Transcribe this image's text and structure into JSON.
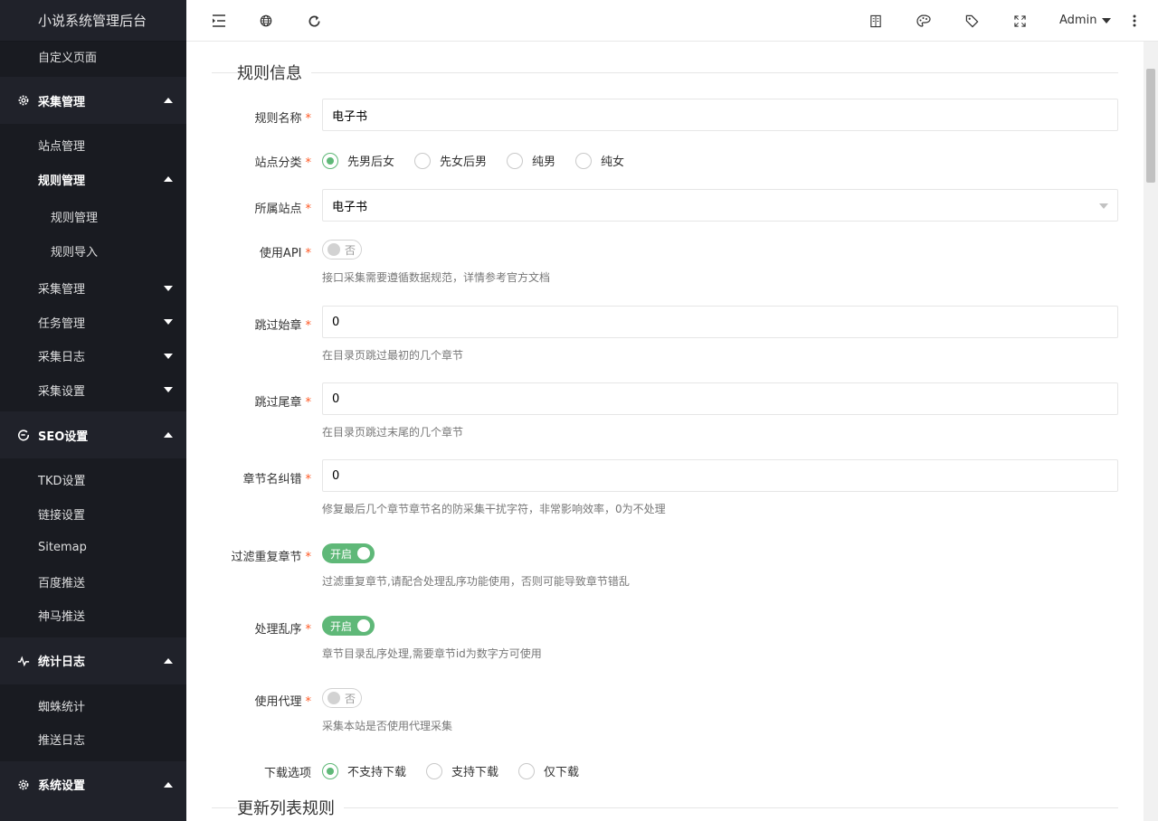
{
  "sidebar": {
    "title": "小说系统管理后台",
    "top_item": "自定义页面",
    "groups": [
      {
        "label": "采集管理",
        "icon": "gear-icon"
      },
      {
        "label": "SEO设置",
        "icon": "refresh-c-icon"
      },
      {
        "label": "统计日志",
        "icon": "pulse-icon"
      },
      {
        "label": "系统设置",
        "icon": "gear-icon"
      }
    ],
    "collect_items": {
      "site": "站点管理",
      "rule": "规则管理",
      "rule_sub": [
        "规则管理",
        "规则导入"
      ],
      "collect": "采集管理",
      "task": "任务管理",
      "log": "采集日志",
      "settings": "采集设置"
    },
    "seo_items": [
      "TKD设置",
      "链接设置",
      "Sitemap",
      "百度推送",
      "神马推送"
    ],
    "stat_items": [
      "蜘蛛统计",
      "推送日志"
    ]
  },
  "topbar": {
    "user": "Admin",
    "icons": [
      "menu-fold-icon",
      "globe-icon",
      "refresh-icon",
      "book-icon",
      "palette-icon",
      "tag-icon",
      "fullscreen-icon",
      "more-vertical-icon"
    ]
  },
  "form": {
    "section_title": "规则信息",
    "next_section_title": "更新列表规则",
    "rule_name": {
      "label": "规则名称",
      "value": "电子书"
    },
    "site_category": {
      "label": "站点分类",
      "options": [
        "先男后女",
        "先女后男",
        "纯男",
        "纯女"
      ],
      "selected": "先男后女"
    },
    "site": {
      "label": "所属站点",
      "value": "电子书"
    },
    "use_api": {
      "label": "使用API",
      "state": "否",
      "help": "接口采集需要遵循数据规范，详情参考官方文档"
    },
    "skip_start": {
      "label": "跳过始章",
      "value": "0",
      "help": "在目录页跳过最初的几个章节"
    },
    "skip_end": {
      "label": "跳过尾章",
      "value": "0",
      "help": "在目录页跳过末尾的几个章节"
    },
    "chapter_fix": {
      "label": "章节名纠错",
      "value": "0",
      "help": "修复最后几个章节章节名的防采集干扰字符，非常影响效率，0为不处理"
    },
    "filter_dup": {
      "label": "过滤重复章节",
      "state": "开启",
      "help": "过滤重复章节,请配合处理乱序功能使用，否则可能导致章节错乱"
    },
    "disorder": {
      "label": "处理乱序",
      "state": "开启",
      "help": "章节目录乱序处理,需要章节id为数字方可使用"
    },
    "proxy": {
      "label": "使用代理",
      "state": "否",
      "help": "采集本站是否使用代理采集"
    },
    "download": {
      "label": "下载选项",
      "options": [
        "不支持下载",
        "支持下载",
        "仅下载"
      ],
      "selected": "不支持下载"
    },
    "required_mark": "*"
  },
  "colors": {
    "accent": "#5fb878",
    "sidebar_bg": "#20222a",
    "required": "#ff5722"
  }
}
